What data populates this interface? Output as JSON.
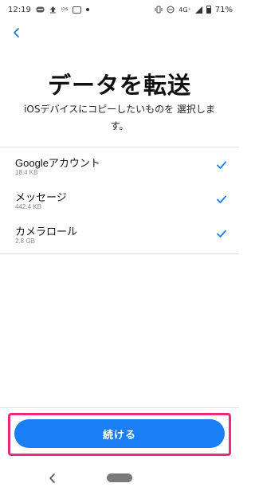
{
  "status_bar": {
    "time": "12:19",
    "network": "4G⁺",
    "battery": "71%"
  },
  "header": {
    "title": "データを転送",
    "subtitle": "iOSデバイスにコピーしたいものを 選択します。"
  },
  "items": [
    {
      "name": "Googleアカウント",
      "size": "18.4 KB",
      "checked": true
    },
    {
      "name": "メッセージ",
      "size": "442.4 KB",
      "checked": true
    },
    {
      "name": "カメラロール",
      "size": "2.8 GB",
      "checked": true
    }
  ],
  "footer": {
    "continue_label": "続ける"
  },
  "colors": {
    "accent": "#1a7ff5",
    "highlight": "#ee2a7b"
  }
}
